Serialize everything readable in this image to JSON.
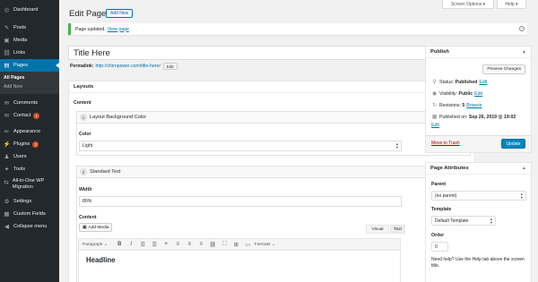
{
  "sidebar": {
    "items": [
      {
        "label": "Dashboard",
        "icon": "dashboard-icon",
        "glyph": "◎"
      },
      {
        "label": "Posts",
        "icon": "pin-icon",
        "glyph": "✎"
      },
      {
        "label": "Media",
        "icon": "media-icon",
        "glyph": "▣"
      },
      {
        "label": "Links",
        "icon": "link-icon",
        "glyph": "⛓"
      },
      {
        "label": "Pages",
        "icon": "pages-icon",
        "glyph": "▤"
      },
      {
        "label": "Comments",
        "icon": "comment-icon",
        "glyph": "✉"
      },
      {
        "label": "Contact",
        "icon": "envelope-icon",
        "glyph": "✉",
        "badge": "1"
      },
      {
        "label": "Appearance",
        "icon": "brush-icon",
        "glyph": "✏"
      },
      {
        "label": "Plugins",
        "icon": "plug-icon",
        "glyph": "⚡",
        "badge": "2"
      },
      {
        "label": "Users",
        "icon": "user-icon",
        "glyph": "♟"
      },
      {
        "label": "Tools",
        "icon": "wrench-icon",
        "glyph": "✦"
      },
      {
        "label": "All-in-One WP Migration",
        "icon": "migration-icon",
        "glyph": "⇆"
      },
      {
        "label": "Settings",
        "icon": "settings-icon",
        "glyph": "⚙"
      },
      {
        "label": "Custom Fields",
        "icon": "grid-icon",
        "glyph": "▦"
      },
      {
        "label": "Collapse menu",
        "icon": "collapse-icon",
        "glyph": "◀"
      }
    ],
    "submenu": [
      "All Pages",
      "Add New"
    ]
  },
  "topbar": {
    "screen_options": "Screen Options ▾",
    "help": "Help ▾"
  },
  "header": {
    "title": "Edit Page",
    "add_new": "Add New"
  },
  "notice": {
    "text": "Page updated.",
    "link": "View page",
    "dismiss": "×"
  },
  "editor": {
    "title_value": "Title Here",
    "permalink_label": "Permalink:",
    "permalink_url": "http://chiropower.com/title-here/",
    "edit_button": "Edit"
  },
  "layouts": {
    "title": "Layouts",
    "content_label": "Content",
    "block1": {
      "num": "1",
      "title": "Layout Background Color",
      "field": "Color",
      "value": "Light"
    },
    "block2": {
      "num": "2",
      "title": "Standard Text",
      "width_label": "Width",
      "width_value": "80%",
      "content_label": "Content"
    },
    "add_media": "Add Media",
    "tab_visual": "Visual",
    "tab_text": "Text",
    "paragraph": "Paragraph",
    "formats": "Formats",
    "toolbar_icons": [
      "B",
      "I",
      "☰",
      "☰",
      "❝",
      "≡",
      "≡",
      "≡",
      "⛓",
      "⛶",
      "⊞",
      "▭"
    ],
    "body_heading": "Headline"
  },
  "publish": {
    "title": "Publish",
    "preview": "Preview Changes",
    "status_label": "Status:",
    "status_value": "Published",
    "status_edit": "Edit",
    "visibility_label": "Visibility:",
    "visibility_value": "Public",
    "visibility_edit": "Edit",
    "revisions_label": "Revisions:",
    "revisions_value": "5",
    "revisions_link": "Browse",
    "published_label": "Published on:",
    "published_value": "Sep 26, 2019 @ 19:02",
    "published_edit": "Edit",
    "trash": "Move to Trash",
    "update": "Update"
  },
  "attributes": {
    "title": "Page Attributes",
    "parent_label": "Parent",
    "parent_value": "(no parent)",
    "template_label": "Template",
    "template_value": "Default Template",
    "order_label": "Order",
    "order_value": "0",
    "help": "Need help? Use the Help tab above the screen title."
  },
  "colors": {
    "sidebar": "#23282d",
    "accent": "#0073aa",
    "primary_button": "#0085ba",
    "badge": "#d54e21",
    "notice": "#46b450"
  }
}
